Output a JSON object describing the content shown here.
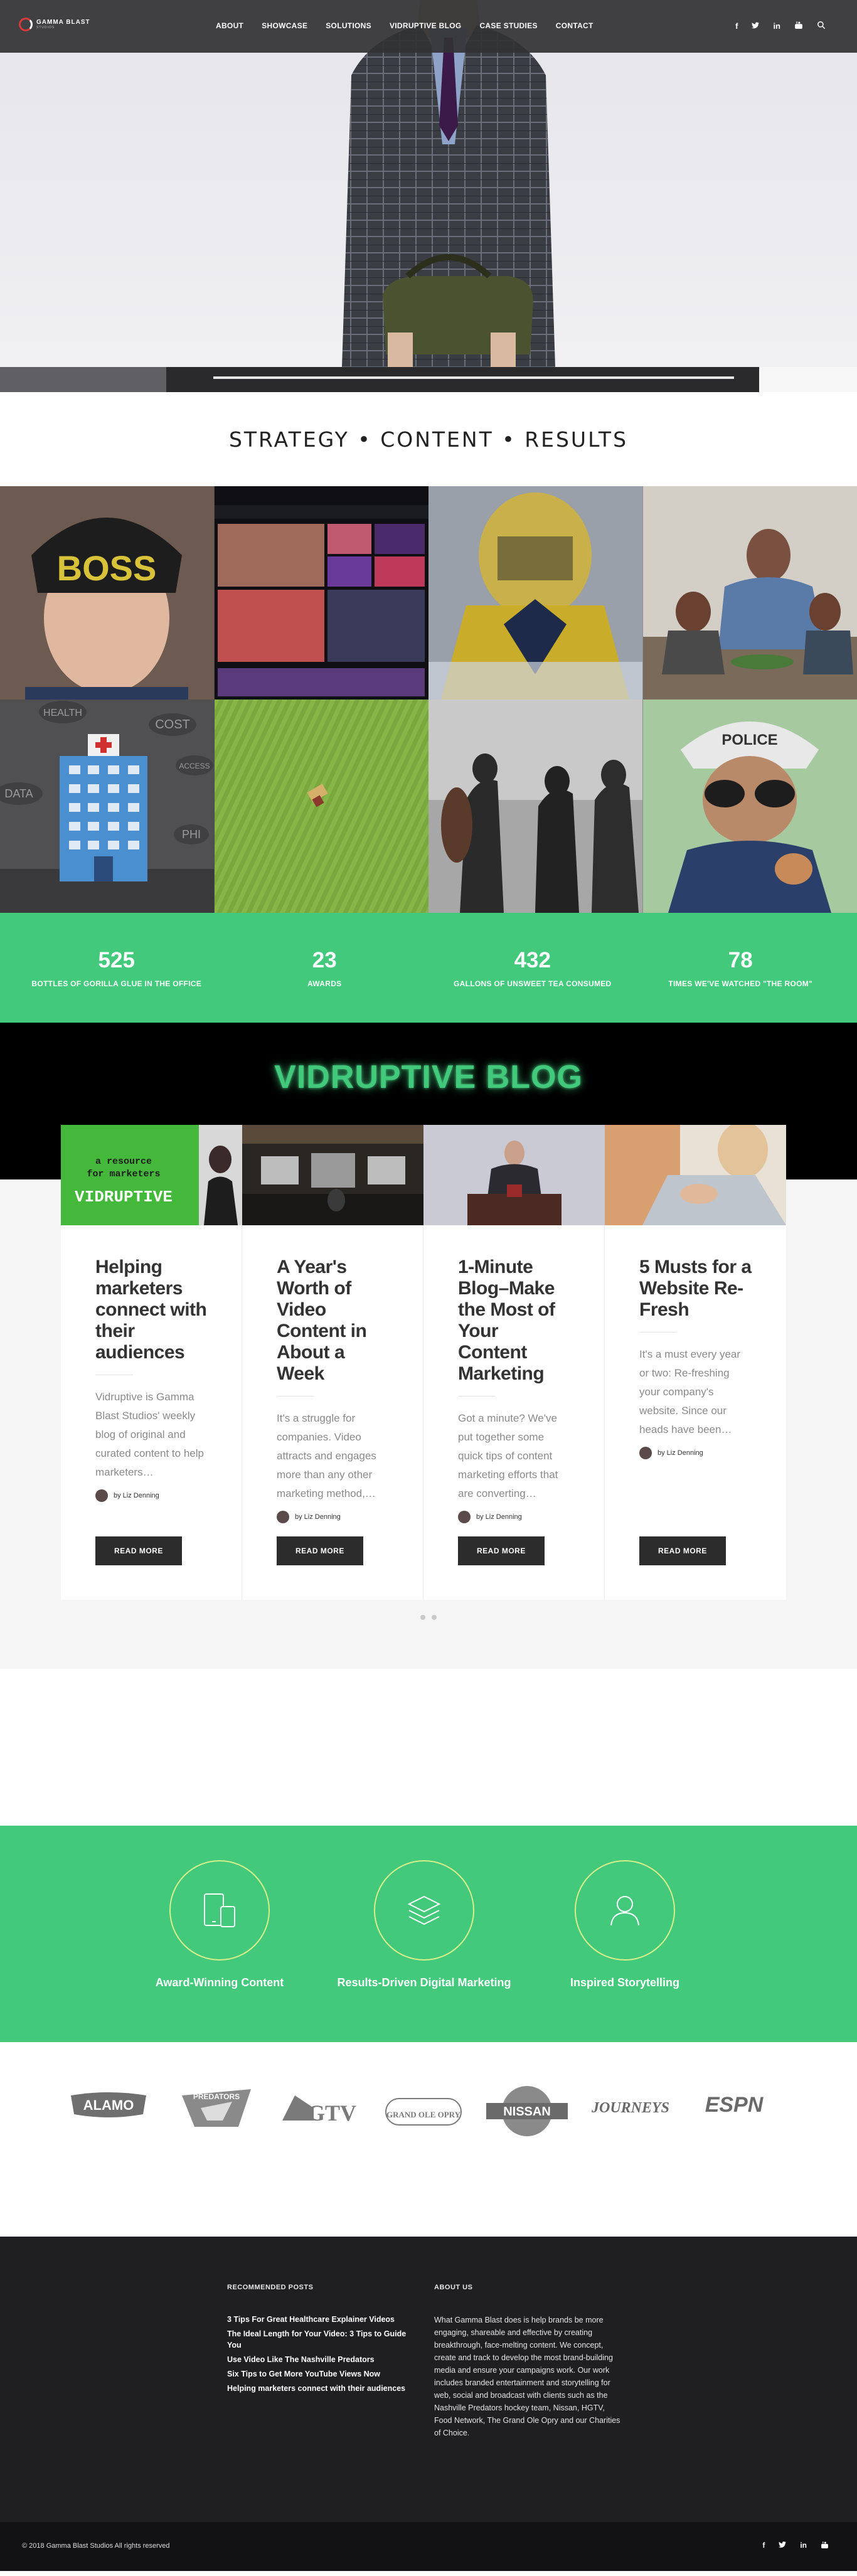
{
  "header": {
    "logo_text": "GAMMA BLAST",
    "logo_sub": "STUDIOS",
    "nav": [
      "ABOUT",
      "SHOWCASE",
      "SOLUTIONS",
      "VIDRUPTIVE BLOG",
      "CASE STUDIES",
      "CONTACT"
    ],
    "social": [
      "f",
      "t",
      "in",
      "yt",
      "search"
    ]
  },
  "tagline": "STRATEGY  •  CONTENT  •  RESULTS",
  "grid": {
    "tiles": [
      {
        "name": "boss-tile",
        "text": "BOSS"
      },
      {
        "name": "channel-tile",
        "text": ""
      },
      {
        "name": "goalie-tile",
        "text": ""
      },
      {
        "name": "cooking-tile",
        "text": ""
      },
      {
        "name": "healthcare-tile",
        "labels": [
          "HEALTH",
          "COST",
          "DATA",
          "ACCESS",
          "PHI"
        ]
      },
      {
        "name": "field-tile",
        "text": ""
      },
      {
        "name": "band-tile",
        "text": ""
      },
      {
        "name": "police-tile",
        "text": "POLICE"
      }
    ]
  },
  "stats": [
    {
      "num": "525",
      "label": "BOTTLES OF GORILLA GLUE IN THE OFFICE"
    },
    {
      "num": "23",
      "label": "AWARDS"
    },
    {
      "num": "432",
      "label": "GALLONS OF UNSWEET TEA CONSUMED"
    },
    {
      "num": "78",
      "label": "TIMES WE'VE WATCHED \"THE ROOM\""
    }
  ],
  "blog": {
    "title": "VIDRUPTIVE BLOG",
    "card1_banner_a": "a resource",
    "card1_banner_b": "for marketers",
    "card1_banner_c": "VIDRUPTIVE",
    "cards": [
      {
        "title": "Helping marketers connect with their audiences",
        "excerpt": "Vidruptive is Gamma Blast Studios' weekly blog of original and curated content to help marketers…",
        "author": "by Liz Denning",
        "button": "READ MORE"
      },
      {
        "title": "A Year's Worth of Video Content in About a Week",
        "excerpt": "It's a struggle for companies. Video attracts and engages more than any other marketing method,…",
        "author": "by Liz Denning",
        "button": "READ MORE"
      },
      {
        "title": "1-Minute Blog–Make the Most of Your Content Marketing",
        "excerpt": "Got a minute? We've put together some quick tips of content marketing efforts that are converting…",
        "author": "by Liz Denning",
        "button": "READ MORE"
      },
      {
        "title": "5 Musts for a Website Re-Fresh",
        "excerpt": "It's a must every year or two: Re-freshing your company's website. Since our heads have been…",
        "author": "by Liz Denning",
        "button": "READ MORE"
      }
    ]
  },
  "features": [
    {
      "label": "Award-Winning Content",
      "icon": "devices-icon"
    },
    {
      "label": "Results-Driven Digital Marketing",
      "icon": "layers-icon"
    },
    {
      "label": "Inspired Storytelling",
      "icon": "user-icon"
    }
  ],
  "clients": [
    "ALAMO",
    "PREDATORS",
    "HGTV",
    "GRAND OLE OPRY",
    "NISSAN",
    "JOURNEYS",
    "ESPN"
  ],
  "footer": {
    "recent_title": "RECOMMENDED POSTS",
    "recent": [
      "3 Tips For Great Healthcare Explainer Videos",
      "The Ideal Length for Your Video: 3 Tips to Guide You",
      "Use Video Like The Nashville Predators",
      "Six Tips to Get More YouTube Views Now",
      "Helping marketers connect with their audiences"
    ],
    "about_title": "ABOUT US",
    "about_text": "What Gamma Blast does is help brands be more engaging, shareable and effective by creating breakthrough, face-melting content. We concept, create and track to develop the most brand-building media and ensure your campaigns work. Our work includes branded entertainment and storytelling for web, social and broadcast with clients such as the Nashville Predators hockey team, Nissan, HGTV, Food Network, The Grand Ole Opry and our Charities of Choice.",
    "copyright": "© 2018 Gamma Blast Studios All rights reserved",
    "social": [
      "f",
      "t",
      "in",
      "yt"
    ]
  },
  "colors": {
    "accent": "#43c97c",
    "dark": "#1f1f21"
  }
}
